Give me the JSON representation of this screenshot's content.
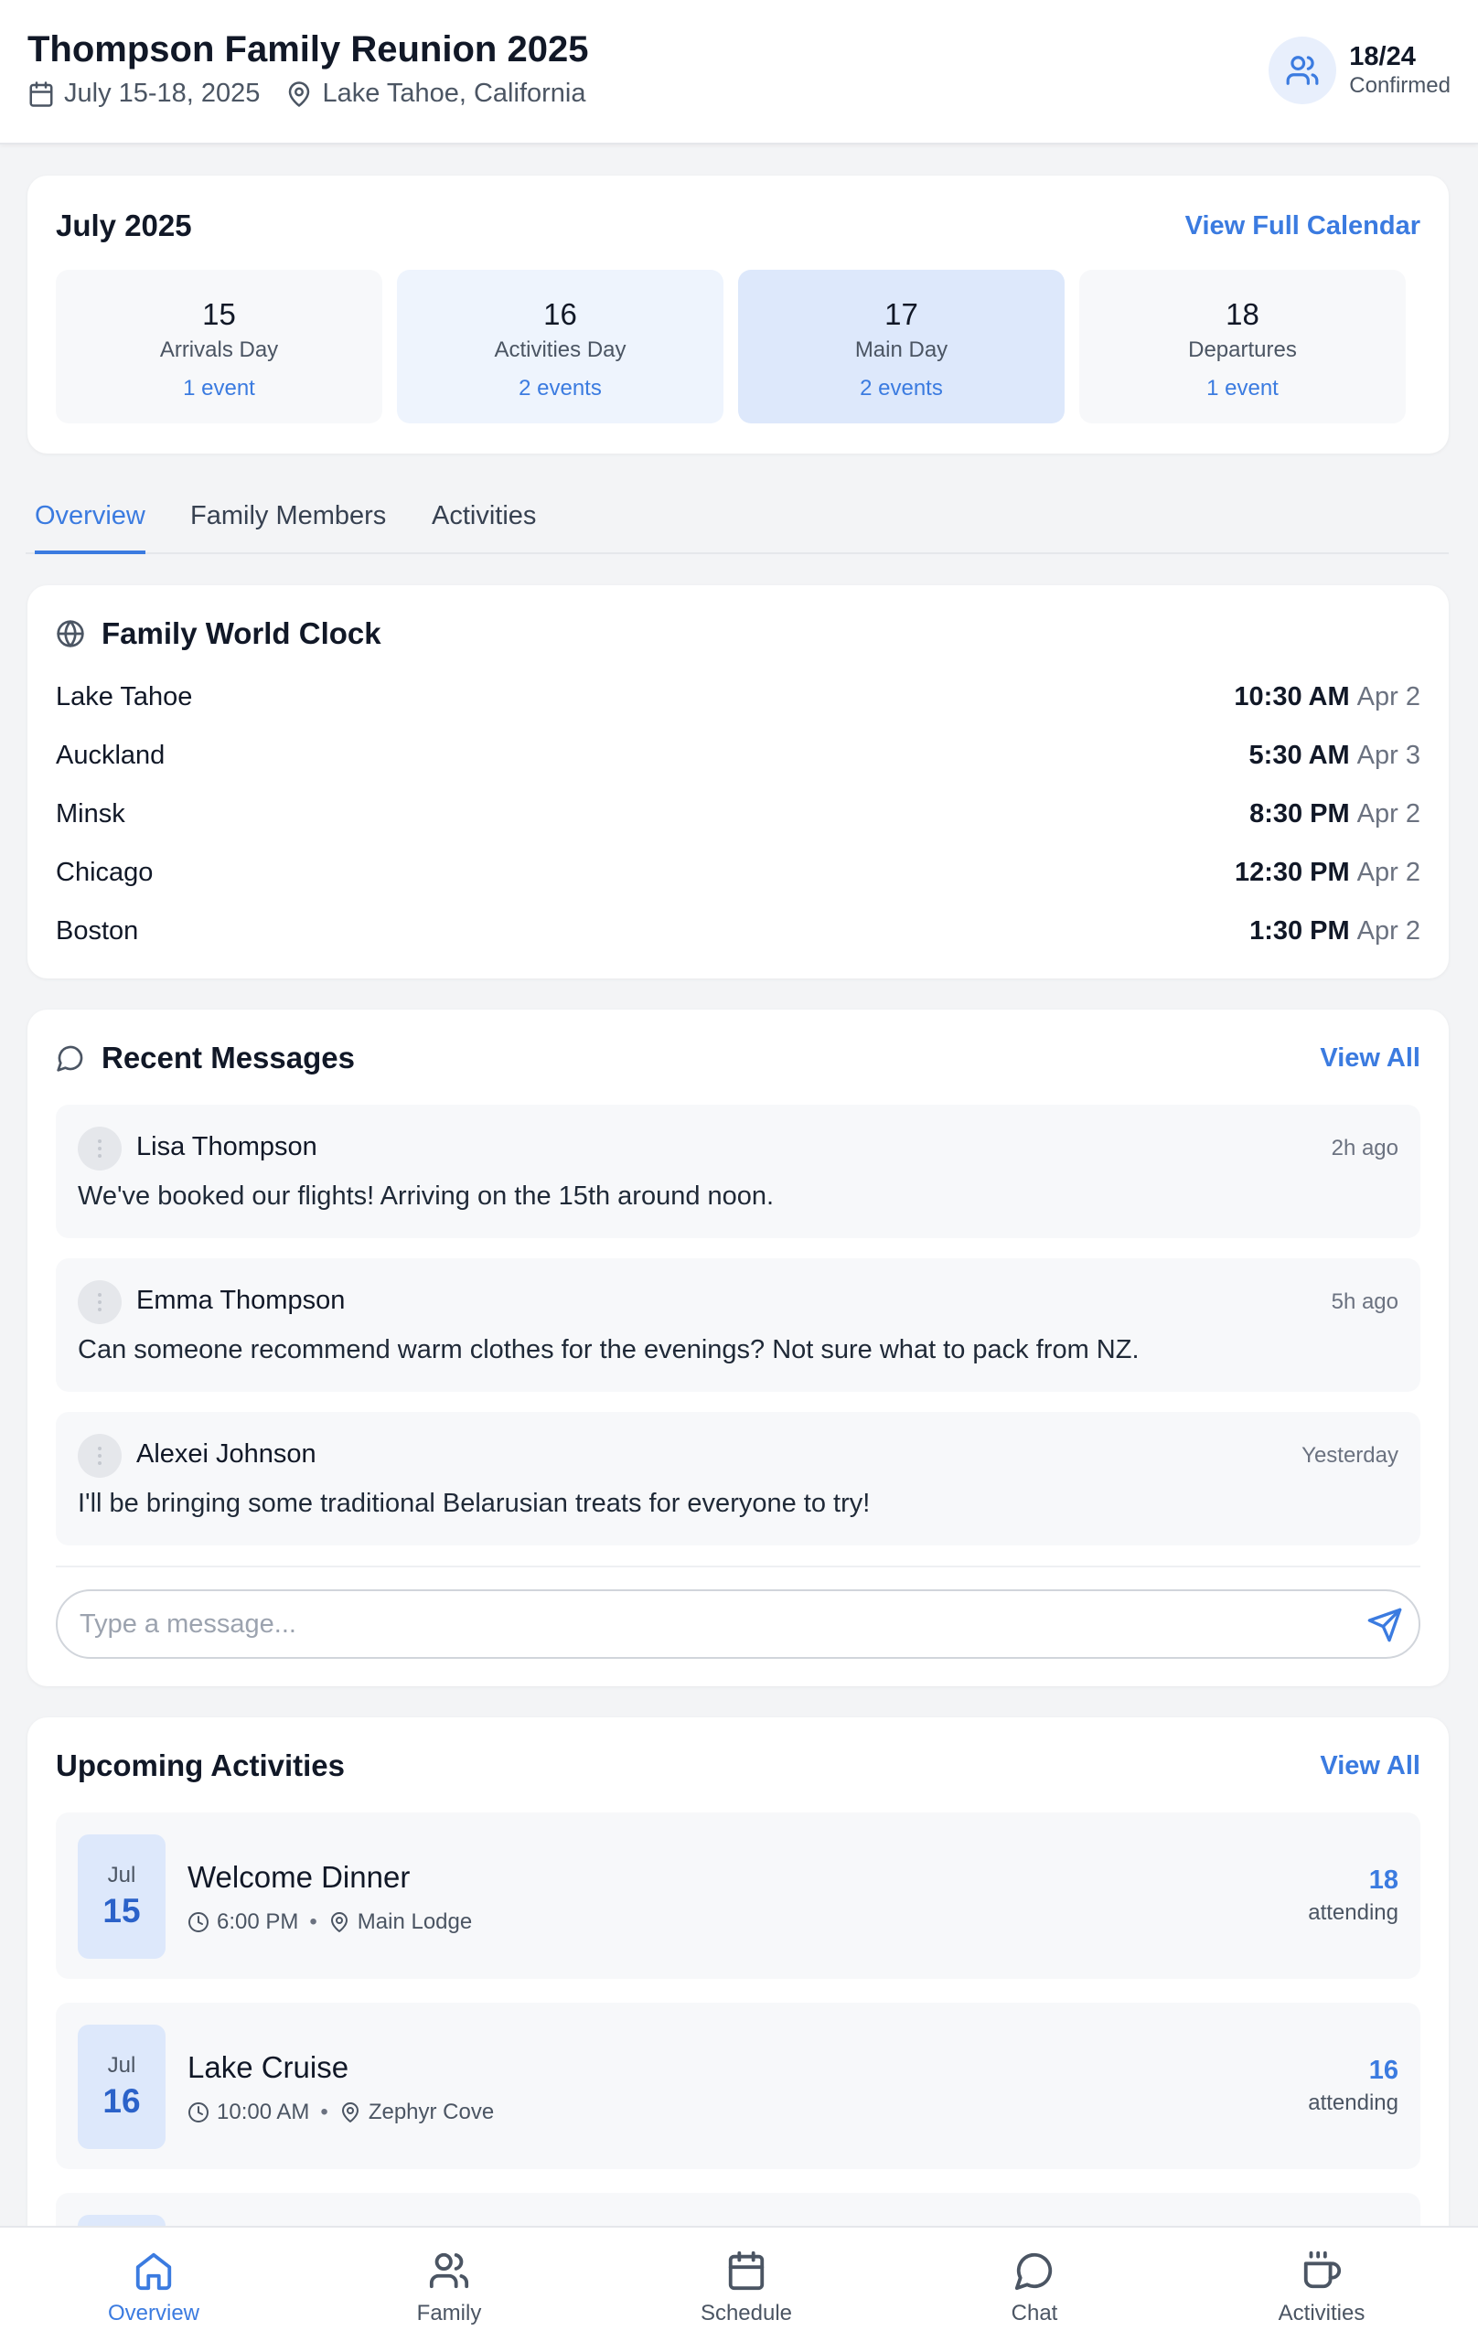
{
  "header": {
    "title": "Thompson Family Reunion 2025",
    "dates": "July 15-18, 2025",
    "location": "Lake Tahoe, California",
    "confirmed_count": "18/24",
    "confirmed_label": "Confirmed"
  },
  "calendar": {
    "month": "July 2025",
    "link": "View Full Calendar",
    "days": [
      {
        "num": "15",
        "label": "Arrivals Day",
        "events": "1 event"
      },
      {
        "num": "16",
        "label": "Activities Day",
        "events": "2 events"
      },
      {
        "num": "17",
        "label": "Main Day",
        "events": "2 events"
      },
      {
        "num": "18",
        "label": "Departures",
        "events": "1 event"
      }
    ]
  },
  "tabs": [
    "Overview",
    "Family Members",
    "Activities"
  ],
  "world_clock": {
    "title": "Family World Clock",
    "rows": [
      {
        "city": "Lake Tahoe",
        "time": "10:30 AM",
        "date": "Apr 2"
      },
      {
        "city": "Auckland",
        "time": "5:30 AM",
        "date": "Apr 3"
      },
      {
        "city": "Minsk",
        "time": "8:30 PM",
        "date": "Apr 2"
      },
      {
        "city": "Chicago",
        "time": "12:30 PM",
        "date": "Apr 2"
      },
      {
        "city": "Boston",
        "time": "1:30 PM",
        "date": "Apr 2"
      }
    ]
  },
  "messages": {
    "title": "Recent Messages",
    "link": "View All",
    "items": [
      {
        "name": "Lisa Thompson",
        "when": "2h ago",
        "text": "We've booked our flights! Arriving on the 15th around noon."
      },
      {
        "name": "Emma Thompson",
        "when": "5h ago",
        "text": "Can someone recommend warm clothes for the evenings? Not sure what to pack from NZ."
      },
      {
        "name": "Alexei Johnson",
        "when": "Yesterday",
        "text": "I'll be bringing some traditional Belarusian treats for everyone to try!"
      }
    ],
    "input_placeholder": "Type a message..."
  },
  "activities": {
    "title": "Upcoming Activities",
    "link": "View All",
    "items": [
      {
        "month": "Jul",
        "day": "15",
        "title": "Welcome Dinner",
        "time": "6:00 PM",
        "place": "Main Lodge",
        "attending": "18",
        "attending_label": "attending"
      },
      {
        "month": "Jul",
        "day": "16",
        "title": "Lake Cruise",
        "time": "10:00 AM",
        "place": "Zephyr Cove",
        "attending": "16",
        "attending_label": "attending"
      }
    ]
  },
  "bottom_nav": [
    "Overview",
    "Family",
    "Schedule",
    "Chat",
    "Activities"
  ],
  "colors": {
    "accent": "#3b7be0",
    "day_light": "#eef4fd",
    "day_selected": "#dde8fb",
    "card_bg": "#ffffff",
    "page_bg": "#f3f4f6"
  }
}
